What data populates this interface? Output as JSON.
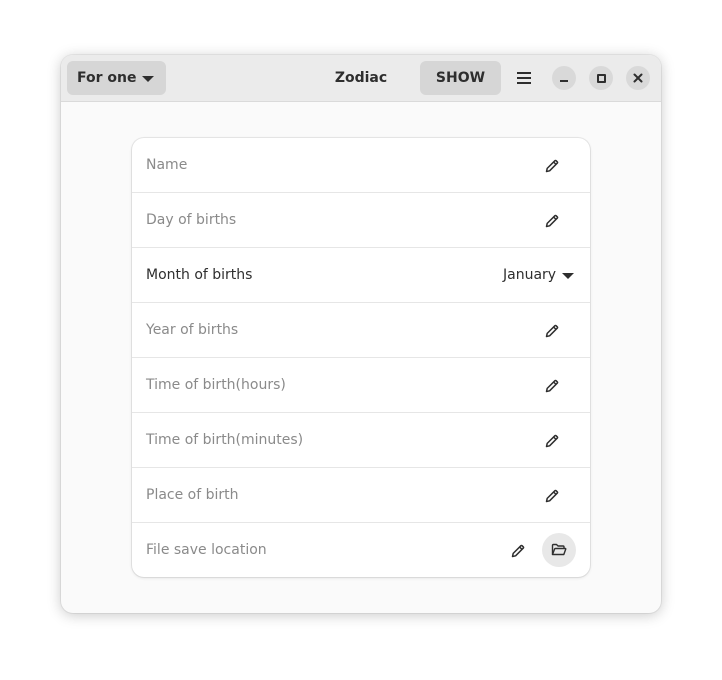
{
  "header": {
    "mode_label": "For one",
    "title": "Zodiac",
    "show_label": "SHOW"
  },
  "form": {
    "name_placeholder": "Name",
    "day_placeholder": "Day of births",
    "month_label": "Month of births",
    "month_value": "January",
    "year_placeholder": "Year of births",
    "hours_placeholder": "Time of birth(hours)",
    "minutes_placeholder": "Time of birth(minutes)",
    "place_placeholder": "Place of birth",
    "file_placeholder": "File save location"
  },
  "icons": {
    "mode": "chevron-down-icon",
    "menu": "hamburger-menu-icon",
    "minimize": "minimize-icon",
    "maximize": "maximize-icon",
    "close": "close-icon",
    "edit": "pencil-icon",
    "folder": "folder-open-icon"
  },
  "colors": {
    "headerbar": "#ebebeb",
    "window_bg": "#fafafa",
    "button_bg": "#d6d6d6",
    "placeholder_text": "#8a8a8a",
    "text": "#2e2e2e"
  }
}
